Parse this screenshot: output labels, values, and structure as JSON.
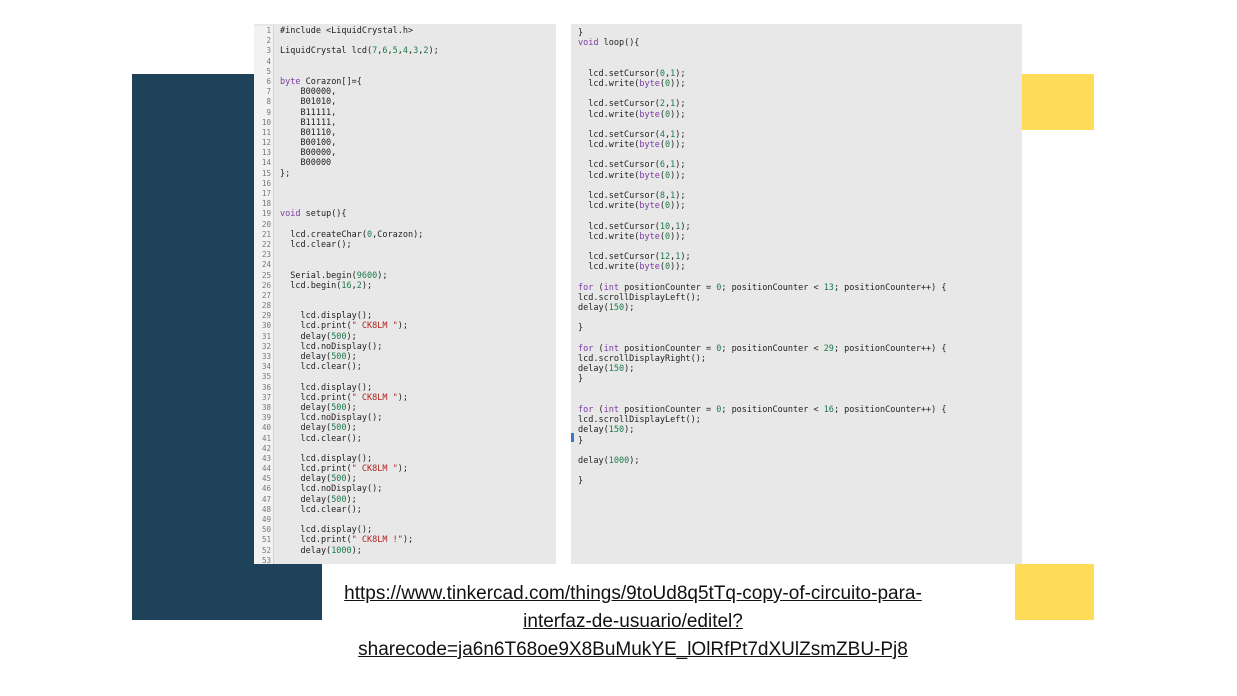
{
  "colors": {
    "navy": "#1d4259",
    "yellow": "#ffdc57",
    "panel": "#e8e8e8"
  },
  "left_code": [
    "#include <LiquidCrystal.h>",
    "",
    "LiquidCrystal lcd(7,6,5,4,3,2);",
    "",
    "",
    "byte Corazon[]={",
    "    B00000,",
    "    B01010,",
    "    B11111,",
    "    B11111,",
    "    B01110,",
    "    B00100,",
    "    B00000,",
    "    B00000",
    "};",
    "",
    "",
    "",
    "void setup(){",
    "",
    "  lcd.createChar(0,Corazon);",
    "  lcd.clear();",
    "",
    "",
    "  Serial.begin(9600);",
    "  lcd.begin(16,2);",
    "",
    "",
    "    lcd.display();",
    "    lcd.print(\" CK8LM \");",
    "    delay(500);",
    "    lcd.noDisplay();",
    "    delay(500);",
    "    lcd.clear();",
    "",
    "    lcd.display();",
    "    lcd.print(\" CK8LM \");",
    "    delay(500);",
    "    lcd.noDisplay();",
    "    delay(500);",
    "    lcd.clear();",
    "",
    "    lcd.display();",
    "    lcd.print(\" CK8LM \");",
    "    delay(500);",
    "    lcd.noDisplay();",
    "    delay(500);",
    "    lcd.clear();",
    "",
    "    lcd.display();",
    "    lcd.print(\" CK8LM !\");",
    "    delay(1000);",
    ""
  ],
  "right_code": [
    "}",
    "void loop(){",
    "",
    "",
    "  lcd.setCursor(0,1);",
    "  lcd.write(byte(0));",
    "",
    "  lcd.setCursor(2,1);",
    "  lcd.write(byte(0));",
    "",
    "  lcd.setCursor(4,1);",
    "  lcd.write(byte(0));",
    "",
    "  lcd.setCursor(6,1);",
    "  lcd.write(byte(0));",
    "",
    "  lcd.setCursor(8,1);",
    "  lcd.write(byte(0));",
    "",
    "  lcd.setCursor(10,1);",
    "  lcd.write(byte(0));",
    "",
    "  lcd.setCursor(12,1);",
    "  lcd.write(byte(0));",
    "",
    "for (int positionCounter = 0; positionCounter < 13; positionCounter++) {",
    "lcd.scrollDisplayLeft();",
    "delay(150);",
    "",
    "}",
    "",
    "for (int positionCounter = 0; positionCounter < 29; positionCounter++) {",
    "lcd.scrollDisplayRight();",
    "delay(150);",
    "}",
    "",
    "",
    "for (int positionCounter = 0; positionCounter < 16; positionCounter++) {",
    "lcd.scrollDisplayLeft();",
    "delay(150);",
    "}",
    "",
    "delay(1000);",
    "",
    "}"
  ],
  "link": {
    "text": "https://www.tinkercad.com/things/9toUd8q5tTq-copy-of-circuito-para-interfaz-de-usuario/editel?sharecode=ja6n6T68oe9X8BuMukYE_lOlRfPt7dXUlZsmZBU-Pj8"
  }
}
